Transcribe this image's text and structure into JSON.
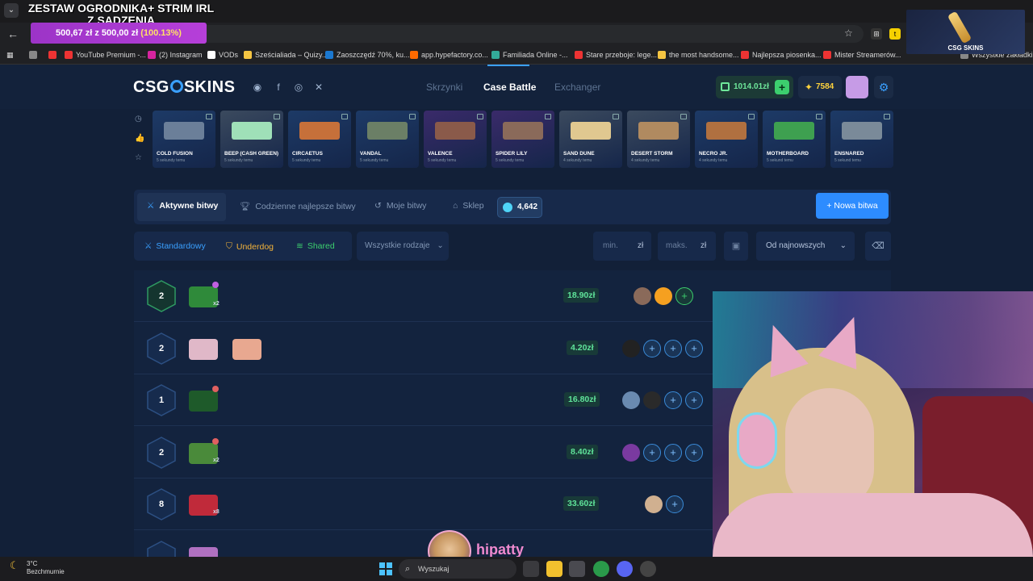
{
  "browser": {
    "bookmarks": [
      {
        "label": "",
        "color": "#888"
      },
      {
        "label": "",
        "color": "#e33"
      },
      {
        "label": "YouTube Premium -...",
        "color": "#e33"
      },
      {
        "label": "(2) Instagram",
        "color": "#d6249f"
      },
      {
        "label": "VODs",
        "color": "#fff"
      },
      {
        "label": "Sześcialiada – Quizy...",
        "color": "#f5c542"
      },
      {
        "label": "Zaoszczędź 70%, ku...",
        "color": "#1b78d0"
      },
      {
        "label": "app.hypefactory.co...",
        "color": "#ff6a00"
      },
      {
        "label": "Familiada Online -...",
        "color": "#3a9"
      },
      {
        "label": "Stare przeboje: lege...",
        "color": "#e33"
      },
      {
        "label": "the most handsome...",
        "color": "#f5c542"
      },
      {
        "label": "Najlepsza piosenka...",
        "color": "#e33"
      },
      {
        "label": "Mister Streamerów...",
        "color": "#e33"
      },
      {
        "label": "Wszystkie zakładki",
        "color": "#888"
      }
    ]
  },
  "overlay": {
    "goal_title": "ZESTAW OGRODNIKA+ STRIM IRL Z SADZENIA",
    "goal_current": "500,67 zł",
    "goal_sep": "z",
    "goal_target": "500,00 zł",
    "goal_pct": "(100.13%)",
    "logo_text": "CSG SKINS",
    "streamer_name": "hipatty"
  },
  "header": {
    "logo_left": "CSG",
    "logo_right": "SKINS",
    "nav": [
      "Skrzynki",
      "Case Battle",
      "Exchanger"
    ],
    "balance": "1014.01zł",
    "coins": "7584"
  },
  "live_drops": [
    {
      "name": "COLD FUSION",
      "time": "5 sekundy temu",
      "bg": "#1d3a66",
      "gun": "#6b7f99"
    },
    {
      "name": "BEEP (CASH GREEN)",
      "time": "5 sekundy temu",
      "bg": "#3b4a5e",
      "gun": "#9fe0b8"
    },
    {
      "name": "CIRCAETUS",
      "time": "5 sekundy temu",
      "bg": "#1d3a66",
      "gun": "#c6703a"
    },
    {
      "name": "VANDAL",
      "time": "5 sekundy temu",
      "bg": "#1d3a66",
      "gun": "#6b7f66"
    },
    {
      "name": "VALENCE",
      "time": "5 sekundy temu",
      "bg": "#3a2a6a",
      "gun": "#8a5a4a"
    },
    {
      "name": "SPIDER LILY",
      "time": "5 sekundy temu",
      "bg": "#3a2a6a",
      "gun": "#8a6a5a"
    },
    {
      "name": "SAND DUNE",
      "time": "4 sekundy temu",
      "bg": "#3b4a5e",
      "gun": "#e0c890"
    },
    {
      "name": "DESERT STORM",
      "time": "4 sekundy temu",
      "bg": "#3b4a5e",
      "gun": "#b08a60"
    },
    {
      "name": "NECRO JR.",
      "time": "4 sekundy temu",
      "bg": "#1d3a66",
      "gun": "#b07040"
    },
    {
      "name": "MOTHERBOARD",
      "time": "5 sekund temu",
      "bg": "#1d3a66",
      "gun": "#3ea050"
    },
    {
      "name": "ENSNARED",
      "time": "5 sekund temu",
      "bg": "#1d3a66",
      "gun": "#7a8a99"
    }
  ],
  "toolbar": {
    "active": "Aktywne bitwy",
    "daily": "Codzienne najlepsze bitwy",
    "mine": "Moje bitwy",
    "shop": "Sklep",
    "gems": "4,642",
    "new_battle": "Nowa bitwa"
  },
  "filters": {
    "standard": "Standardowy",
    "underdog": "Underdog",
    "shared": "Shared",
    "type_select": "Wszystkie rodzaje",
    "min_placeholder": "min.",
    "max_placeholder": "maks.",
    "currency": "zł",
    "sort": "Od najnowszych"
  },
  "battles": [
    {
      "rounds": "2",
      "price": "18.90zł",
      "cases": [
        {
          "color": "#2f8a3a",
          "mult": "x2",
          "badge": "#c060e0"
        }
      ],
      "players": [
        "avatar:#8a6a5a",
        "avatar:#f5a020",
        "empty-green"
      ]
    },
    {
      "rounds": "2",
      "price": "4.20zł",
      "cases": [
        {
          "color": "#e0b8c8",
          "mult": "",
          "badge": ""
        },
        {
          "color": "#e8a890",
          "mult": "",
          "badge": ""
        }
      ],
      "players": [
        "avatar:#222222",
        "empty",
        "empty",
        "empty"
      ]
    },
    {
      "rounds": "1",
      "price": "16.80zł",
      "cases": [
        {
          "color": "#1e5a2a",
          "mult": "",
          "badge": "#e06060"
        }
      ],
      "players": [
        "avatar:#6a8ab0",
        "avatar:#2a2a2a",
        "empty",
        "empty"
      ]
    },
    {
      "rounds": "2",
      "price": "8.40zł",
      "cases": [
        {
          "color": "#4a8a3a",
          "mult": "x2",
          "badge": "#e06060"
        }
      ],
      "players": [
        "avatar:#7a3aa0",
        "empty",
        "empty",
        "empty"
      ]
    },
    {
      "rounds": "8",
      "price": "33.60zł",
      "cases": [
        {
          "color": "#c02a3a",
          "mult": "x8",
          "badge": ""
        }
      ],
      "players": [
        "avatar:#d0b090",
        "empty"
      ]
    },
    {
      "rounds": "",
      "price": "",
      "cases": [
        {
          "color": "#b070c0",
          "mult": "",
          "badge": ""
        }
      ],
      "players": []
    }
  ],
  "taskbar": {
    "temp": "3°C",
    "weather": "Bezchmurnie",
    "search": "Wyszukaj"
  }
}
